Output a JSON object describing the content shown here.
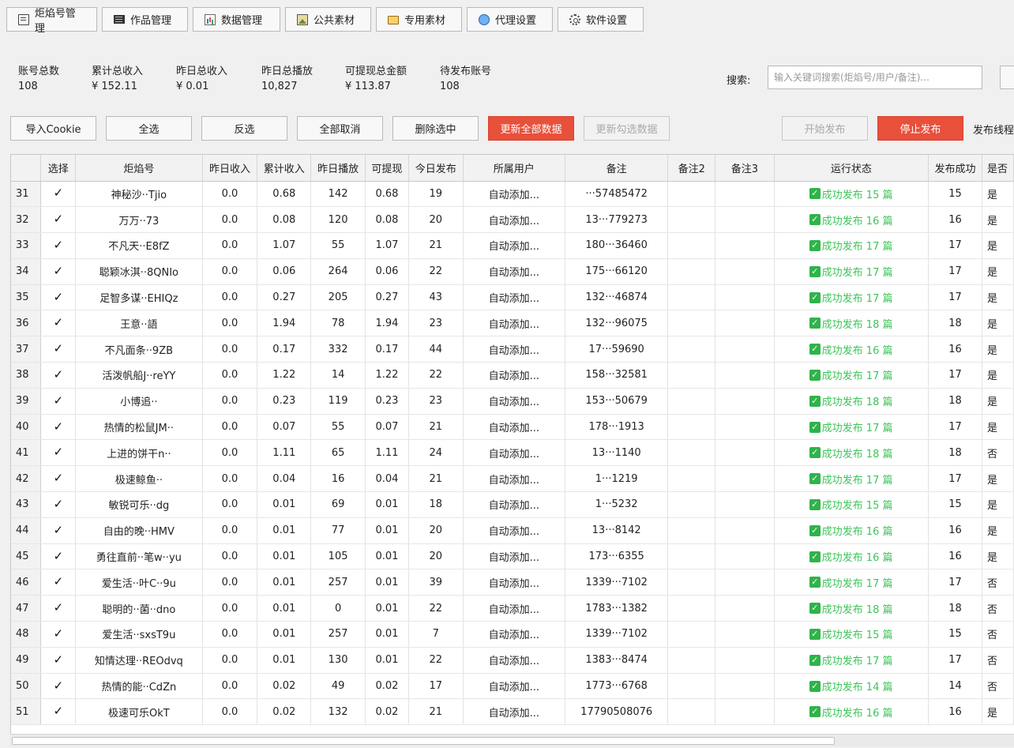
{
  "toolbar": [
    {
      "label": "炬焰号管理",
      "icon": "book-icon",
      "name": "tab-account-manage"
    },
    {
      "label": "作品管理",
      "icon": "film-icon",
      "name": "tab-works-manage"
    },
    {
      "label": "数据管理",
      "icon": "chart-icon",
      "name": "tab-data-manage"
    },
    {
      "label": "公共素材",
      "icon": "image-icon",
      "name": "tab-public-material"
    },
    {
      "label": "专用素材",
      "icon": "folder-icon",
      "name": "tab-private-material"
    },
    {
      "label": "代理设置",
      "icon": "globe-icon",
      "name": "tab-proxy-settings"
    },
    {
      "label": "软件设置",
      "icon": "gear-icon",
      "name": "tab-software-settings"
    }
  ],
  "stats": [
    {
      "label": "账号总数",
      "value": "108"
    },
    {
      "label": "累计总收入",
      "value": "¥ 152.11"
    },
    {
      "label": "昨日总收入",
      "value": "¥ 0.01"
    },
    {
      "label": "昨日总播放",
      "value": "10,827"
    },
    {
      "label": "可提现总金额",
      "value": "¥ 113.87"
    },
    {
      "label": "待发布账号",
      "value": "108"
    }
  ],
  "search": {
    "label": "搜索:",
    "placeholder": "输入关键词搜索(炬焰号/用户/备注)..."
  },
  "actions": {
    "import_cookie": "导入Cookie",
    "select_all": "全选",
    "invert": "反选",
    "deselect_all": "全部取消",
    "delete_selected": "删除选中",
    "update_all": "更新全部数据",
    "update_checked": "更新勾选数据",
    "start_publish": "开始发布",
    "stop_publish": "停止发布",
    "publish_threads": "发布线程"
  },
  "colors": {
    "accent_red": "#e8503b",
    "status_green": "#3ec45a"
  },
  "table": {
    "headers": [
      "选择",
      "炬焰号",
      "昨日收入",
      "累计收入",
      "昨日播放",
      "可提现",
      "今日发布",
      "所属用户",
      "备注",
      "备注2",
      "备注3",
      "运行状态",
      "发布成功",
      "是否"
    ],
    "rows": [
      {
        "num": "31",
        "name": "神秘沙··Tjio",
        "yest": "0.0",
        "total": "0.68",
        "plays": "142",
        "withdraw": "0.68",
        "today": "19",
        "user": "自动添加...",
        "note": "···57485472",
        "status": "成功发布 15 篇",
        "success": "15",
        "flag": "是"
      },
      {
        "num": "32",
        "name": "万万··73",
        "yest": "0.0",
        "total": "0.08",
        "plays": "120",
        "withdraw": "0.08",
        "today": "20",
        "user": "自动添加...",
        "note": "13···779273",
        "status": "成功发布 16 篇",
        "success": "16",
        "flag": "是"
      },
      {
        "num": "33",
        "name": "不凡天··E8fZ",
        "yest": "0.0",
        "total": "1.07",
        "plays": "55",
        "withdraw": "1.07",
        "today": "21",
        "user": "自动添加...",
        "note": "180···36460",
        "status": "成功发布 17 篇",
        "success": "17",
        "flag": "是"
      },
      {
        "num": "34",
        "name": "聪颖冰淇··8QNIo",
        "yest": "0.0",
        "total": "0.06",
        "plays": "264",
        "withdraw": "0.06",
        "today": "22",
        "user": "自动添加...",
        "note": "175···66120",
        "status": "成功发布 17 篇",
        "success": "17",
        "flag": "是"
      },
      {
        "num": "35",
        "name": "足智多谋··EHIQz",
        "yest": "0.0",
        "total": "0.27",
        "plays": "205",
        "withdraw": "0.27",
        "today": "43",
        "user": "自动添加...",
        "note": "132···46874",
        "status": "成功发布 17 篇",
        "success": "17",
        "flag": "是"
      },
      {
        "num": "36",
        "name": "王意··語",
        "yest": "0.0",
        "total": "1.94",
        "plays": "78",
        "withdraw": "1.94",
        "today": "23",
        "user": "自动添加...",
        "note": "132···96075",
        "status": "成功发布 18 篇",
        "success": "18",
        "flag": "是"
      },
      {
        "num": "37",
        "name": "不凡面条··9ZB",
        "yest": "0.0",
        "total": "0.17",
        "plays": "332",
        "withdraw": "0.17",
        "today": "44",
        "user": "自动添加...",
        "note": "17···59690",
        "status": "成功发布 16 篇",
        "success": "16",
        "flag": "是"
      },
      {
        "num": "38",
        "name": "活泼帆船J··reYY",
        "yest": "0.0",
        "total": "1.22",
        "plays": "14",
        "withdraw": "1.22",
        "today": "22",
        "user": "自动添加...",
        "note": "158···32581",
        "status": "成功发布 17 篇",
        "success": "17",
        "flag": "是"
      },
      {
        "num": "39",
        "name": "小博追··",
        "yest": "0.0",
        "total": "0.23",
        "plays": "119",
        "withdraw": "0.23",
        "today": "23",
        "user": "自动添加...",
        "note": "153···50679",
        "status": "成功发布 18 篇",
        "success": "18",
        "flag": "是"
      },
      {
        "num": "40",
        "name": "热情的松鼠JM··",
        "yest": "0.0",
        "total": "0.07",
        "plays": "55",
        "withdraw": "0.07",
        "today": "21",
        "user": "自动添加...",
        "note": "178···1913",
        "status": "成功发布 17 篇",
        "success": "17",
        "flag": "是"
      },
      {
        "num": "41",
        "name": "上进的饼干n··",
        "yest": "0.0",
        "total": "1.11",
        "plays": "65",
        "withdraw": "1.11",
        "today": "24",
        "user": "自动添加...",
        "note": "13···1140",
        "status": "成功发布 18 篇",
        "success": "18",
        "flag": "否"
      },
      {
        "num": "42",
        "name": "极速鲸鱼··",
        "yest": "0.0",
        "total": "0.04",
        "plays": "16",
        "withdraw": "0.04",
        "today": "21",
        "user": "自动添加...",
        "note": "1···1219",
        "status": "成功发布 17 篇",
        "success": "17",
        "flag": "是"
      },
      {
        "num": "43",
        "name": "敏锐可乐··dg",
        "yest": "0.0",
        "total": "0.01",
        "plays": "69",
        "withdraw": "0.01",
        "today": "18",
        "user": "自动添加...",
        "note": "1···5232",
        "status": "成功发布 15 篇",
        "success": "15",
        "flag": "是"
      },
      {
        "num": "44",
        "name": "自由的晚··HMV",
        "yest": "0.0",
        "total": "0.01",
        "plays": "77",
        "withdraw": "0.01",
        "today": "20",
        "user": "自动添加...",
        "note": "13···8142",
        "status": "成功发布 16 篇",
        "success": "16",
        "flag": "是"
      },
      {
        "num": "45",
        "name": "勇往直前··笔w··yu",
        "yest": "0.0",
        "total": "0.01",
        "plays": "105",
        "withdraw": "0.01",
        "today": "20",
        "user": "自动添加...",
        "note": "173···6355",
        "status": "成功发布 16 篇",
        "success": "16",
        "flag": "是"
      },
      {
        "num": "46",
        "name": "爱生活··叶C··9u",
        "yest": "0.0",
        "total": "0.01",
        "plays": "257",
        "withdraw": "0.01",
        "today": "39",
        "user": "自动添加...",
        "note": "1339···7102",
        "status": "成功发布 17 篇",
        "success": "17",
        "flag": "否"
      },
      {
        "num": "47",
        "name": "聪明的··菌··dno",
        "yest": "0.0",
        "total": "0.01",
        "plays": "0",
        "withdraw": "0.01",
        "today": "22",
        "user": "自动添加...",
        "note": "1783···1382",
        "status": "成功发布 18 篇",
        "success": "18",
        "flag": "否"
      },
      {
        "num": "48",
        "name": "爱生活··sxsT9u",
        "yest": "0.0",
        "total": "0.01",
        "plays": "257",
        "withdraw": "0.01",
        "today": "7",
        "user": "自动添加...",
        "note": "1339···7102",
        "status": "成功发布 15 篇",
        "success": "15",
        "flag": "否"
      },
      {
        "num": "49",
        "name": "知情达理··REOdvq",
        "yest": "0.0",
        "total": "0.01",
        "plays": "130",
        "withdraw": "0.01",
        "today": "22",
        "user": "自动添加...",
        "note": "1383···8474",
        "status": "成功发布 17 篇",
        "success": "17",
        "flag": "否"
      },
      {
        "num": "50",
        "name": "热情的能··CdZn",
        "yest": "0.0",
        "total": "0.02",
        "plays": "49",
        "withdraw": "0.02",
        "today": "17",
        "user": "自动添加...",
        "note": "1773···6768",
        "status": "成功发布 14 篇",
        "success": "14",
        "flag": "否"
      },
      {
        "num": "51",
        "name": "极速可乐OkT",
        "yest": "0.0",
        "total": "0.02",
        "plays": "132",
        "withdraw": "0.02",
        "today": "21",
        "user": "自动添加...",
        "note": "17790508076",
        "status": "成功发布 16 篇",
        "success": "16",
        "flag": "是"
      }
    ]
  }
}
